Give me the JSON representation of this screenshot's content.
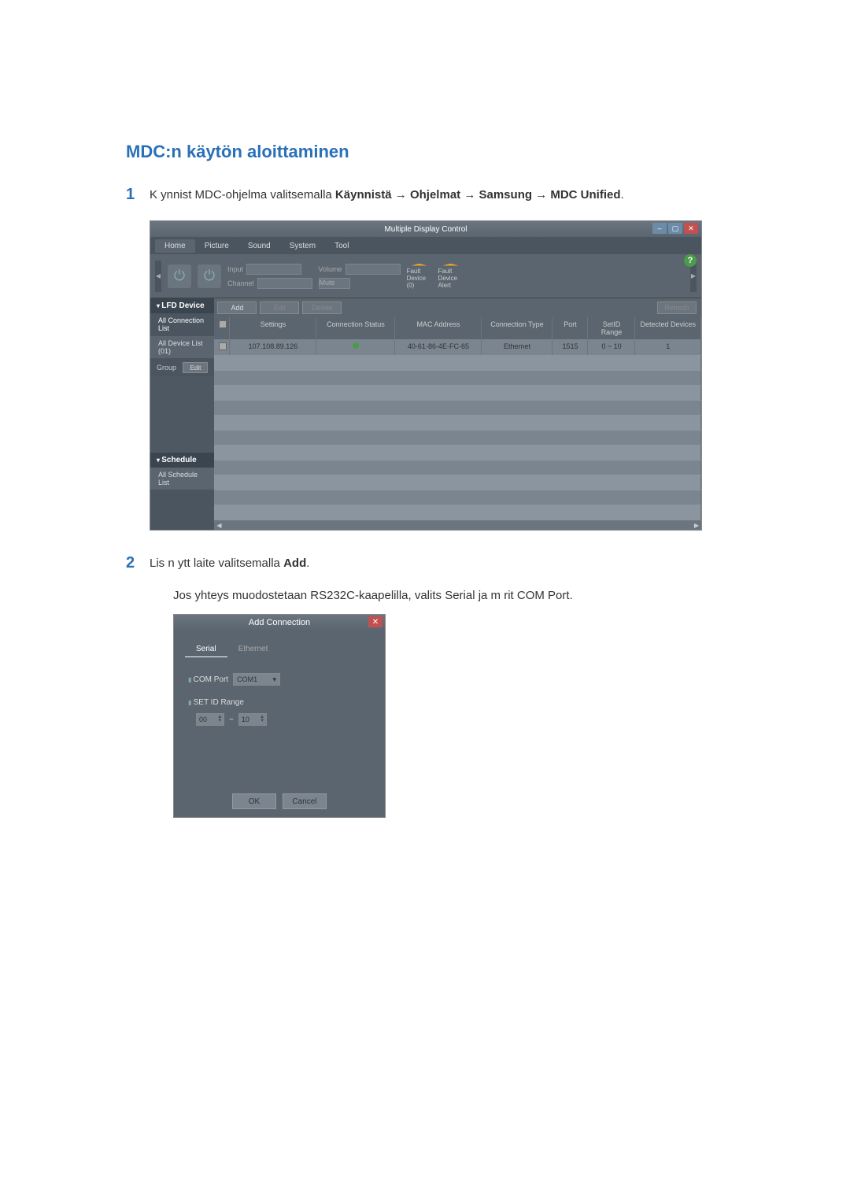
{
  "title": "MDC:n käytön aloittaminen",
  "step1": {
    "num": "1",
    "text_prefix": "K ynnist  MDC-ohjelma valitsemalla",
    "path_start": "Käynnistä",
    "path_programs": "Ohjelmat",
    "path_samsung": "Samsung",
    "path_mdc": "MDC Unified",
    "arrow": "→"
  },
  "app": {
    "title": "Multiple Display Control",
    "menu": {
      "home": "Home",
      "picture": "Picture",
      "sound": "Sound",
      "system": "System",
      "tool": "Tool"
    },
    "toolbar": {
      "input": "Input",
      "channel": "Channel",
      "volume": "Volume",
      "mute": "Mute",
      "fault_device": "Fault Device (0)",
      "fault_alert": "Fault Device Alert"
    },
    "actions": {
      "add": "Add",
      "edit": "Edit",
      "delete": "Delete",
      "refresh": "Refresh"
    },
    "left": {
      "lfd": "LFD Device",
      "all_conn": "All Connection List",
      "all_dev": "All Device List (01)",
      "group": "Group",
      "edit": "Edit",
      "schedule": "Schedule",
      "all_sched": "All Schedule List"
    },
    "table": {
      "headers": {
        "settings": "Settings",
        "cs": "Connection Status",
        "mac": "MAC Address",
        "ct": "Connection Type",
        "port": "Port",
        "sid": "SetID Range",
        "dd": "Detected Devices"
      },
      "row": {
        "settings": "107.108.89.126",
        "mac": "40-61-86-4E-FC-65",
        "ct": "Ethernet",
        "port": "1515",
        "sid": "0 ~ 10",
        "dd": "1"
      }
    }
  },
  "step2": {
    "num": "2",
    "text_prefix": "Lis   n ytt laite valitsemalla ",
    "add": "Add",
    "subtext_prefix": "Jos yhteys muodostetaan RS232C-kaapelilla, valits",
    "serial_bold": "Serial",
    "subtext_mid": " ja m  rit   ",
    "comport_bold": "COM Port"
  },
  "dialog": {
    "title": "Add Connection",
    "tab_serial": "Serial",
    "tab_ethernet": "Ethernet",
    "comport_label": "COM Port",
    "comport_value": "COM1",
    "setid_label": "SET ID Range",
    "range_from": "00",
    "range_sep": "~",
    "range_to": "10",
    "ok": "OK",
    "cancel": "Cancel"
  }
}
